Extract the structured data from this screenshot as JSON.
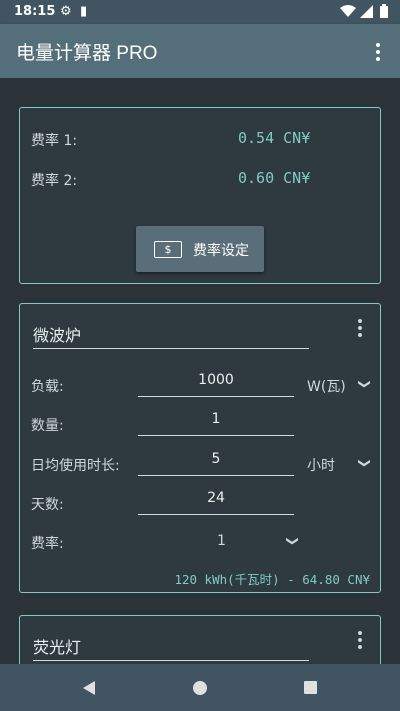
{
  "status": {
    "time": "18:15",
    "icons": [
      "gear-icon",
      "sd-card-icon",
      "wifi-icon",
      "signal-icon",
      "battery-icon"
    ]
  },
  "appbar": {
    "title": "电量计算器 PRO",
    "menu_icon": "more-vert-icon"
  },
  "rates": {
    "rate1_label": "费率 1:",
    "rate1_value": "0.54 CN¥",
    "rate2_label": "费率 2:",
    "rate2_value": "0.60 CN¥",
    "button_label": "费率设定",
    "button_icon": "dollar-bill-icon"
  },
  "appliances": [
    {
      "name": "微波炉",
      "load_label": "负载:",
      "load_value": "1000",
      "load_unit": "W(瓦)",
      "qty_label": "数量:",
      "qty_value": "1",
      "hours_label": "日均使用时长:",
      "hours_value": "5",
      "hours_unit": "小时",
      "days_label": "天数:",
      "days_value": "24",
      "rate_label": "费率:",
      "rate_value": "1",
      "result": "120 kWh(千瓦时) - 64.80 CN¥"
    },
    {
      "name": "荧光灯"
    }
  ],
  "colors": {
    "accent": "#80cbc4",
    "appbar": "#546e7a",
    "background": "#2b3339"
  },
  "navbar": {
    "icons": [
      "back-icon",
      "home-icon",
      "recents-icon"
    ]
  }
}
